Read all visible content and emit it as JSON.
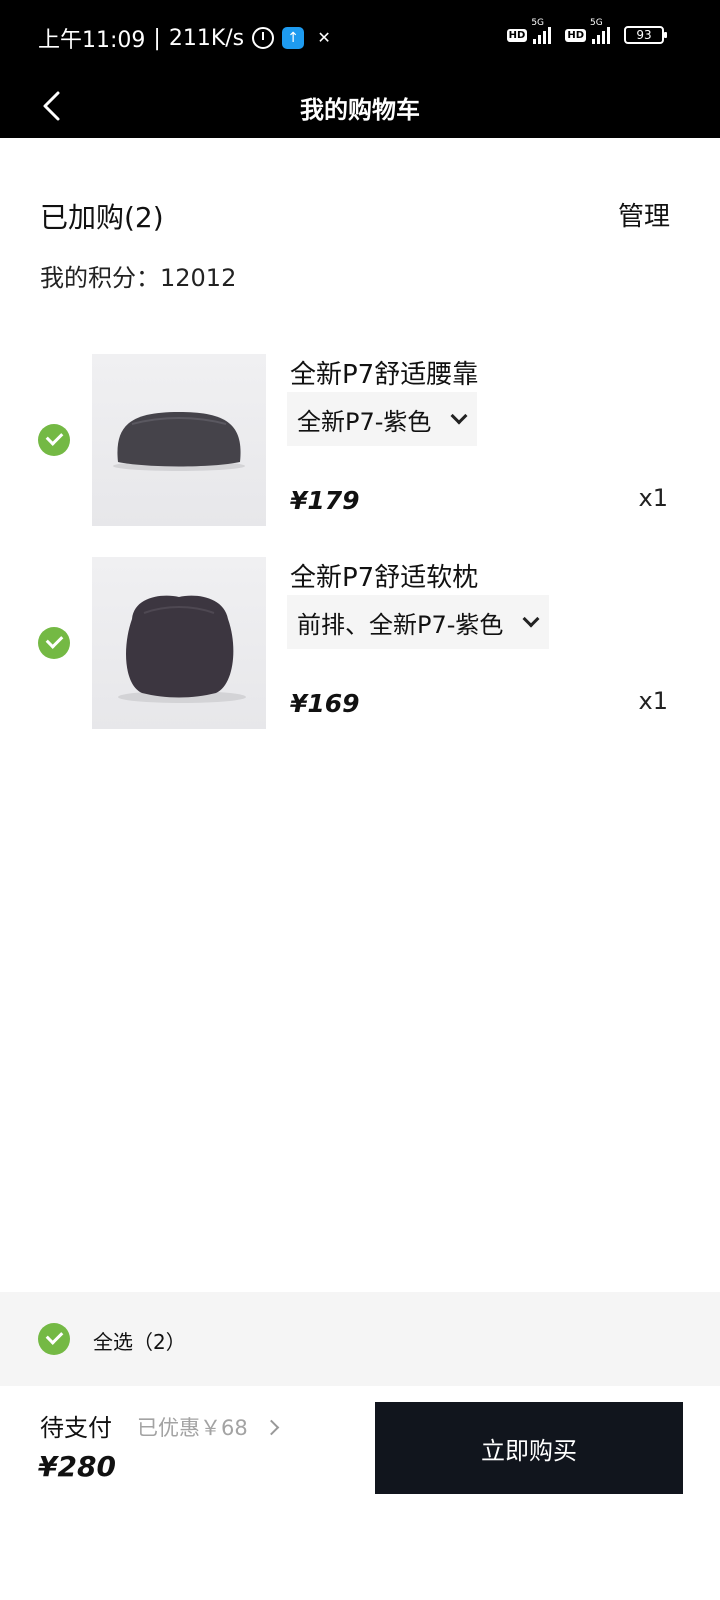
{
  "status_bar": {
    "time": "上午11:09",
    "net_speed": "211K/s",
    "icons": [
      "alarm-icon",
      "upload-app-icon",
      "app-icon"
    ],
    "hd1": "HD",
    "net1": "5G",
    "hd2": "HD",
    "net2": "5G",
    "battery": "93"
  },
  "nav": {
    "title": "我的购物车",
    "back_icon": "chevron-left-icon"
  },
  "cart": {
    "count_label": "已加购(2)",
    "manage_label": "管理",
    "points_label": "我的积分：",
    "points_value": "12012",
    "items": [
      {
        "name": "全新P7舒适腰靠",
        "variant": "全新P7-紫色",
        "price": "¥179",
        "qty": "x1",
        "checked": true
      },
      {
        "name": "全新P7舒适软枕",
        "variant": "前排、全新P7-紫色",
        "price": "¥169",
        "qty": "x1",
        "checked": true
      }
    ]
  },
  "footer": {
    "select_all_label": "全选（2）",
    "due_label": "待支付",
    "discount_label": "已优惠￥68",
    "total": "¥280",
    "buy_label": "立即购买"
  },
  "colors": {
    "check_green": "#74b944",
    "header_bg": "#000000",
    "buy_button_bg": "#11151d",
    "footer_bar_bg": "#f5f5f5"
  }
}
